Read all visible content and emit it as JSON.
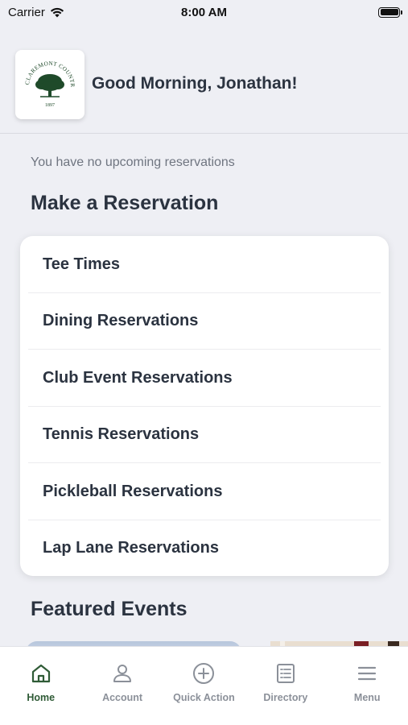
{
  "status_bar": {
    "carrier": "Carrier",
    "time": "8:00 AM"
  },
  "header": {
    "greeting": "Good Morning, Jonathan!",
    "logo": {
      "name": "CLAREMONT COUNTRY CLUB",
      "year": "1897"
    }
  },
  "reservations": {
    "empty_message": "You have no upcoming reservations",
    "title": "Make a Reservation",
    "items": [
      {
        "label": "Tee Times"
      },
      {
        "label": "Dining Reservations"
      },
      {
        "label": "Club Event Reservations"
      },
      {
        "label": "Tennis Reservations"
      },
      {
        "label": "Pickleball Reservations"
      },
      {
        "label": "Lap Lane Reservations"
      }
    ]
  },
  "featured": {
    "title": "Featured Events"
  },
  "tab_bar": {
    "tabs": [
      {
        "label": "Home",
        "icon": "home-icon",
        "active": true
      },
      {
        "label": "Account",
        "icon": "person-icon",
        "active": false
      },
      {
        "label": "Quick Action",
        "icon": "plus-circle-icon",
        "active": false
      },
      {
        "label": "Directory",
        "icon": "list-icon",
        "active": false
      },
      {
        "label": "Menu",
        "icon": "hamburger-icon",
        "active": false
      }
    ],
    "active_color": "#2f5b36",
    "inactive_color": "#8b9099"
  }
}
